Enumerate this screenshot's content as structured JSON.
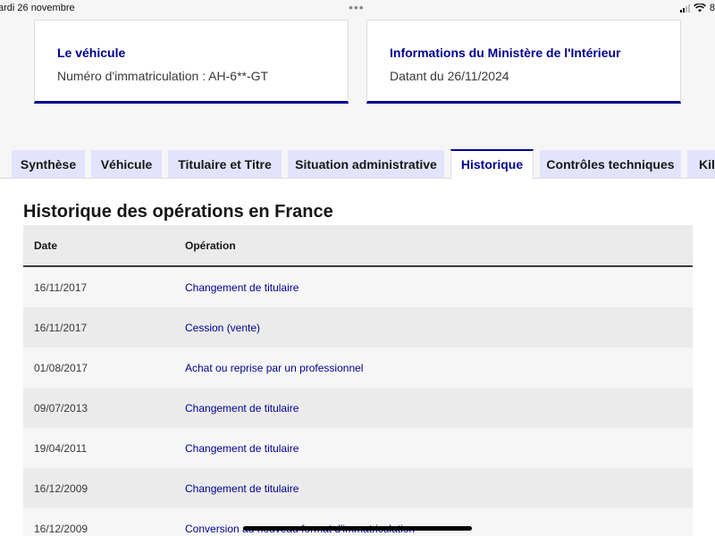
{
  "status_bar": {
    "date": "ardi 26 novembre",
    "battery": "8"
  },
  "cards": [
    {
      "title": "Le véhicule",
      "text": "Numéro d'immatriculation : AH-6**-GT"
    },
    {
      "title": "Informations du Ministère de l'Intérieur",
      "text": "Datant du 26/11/2024"
    }
  ],
  "tabs": [
    {
      "label": "Synthèse",
      "active": false
    },
    {
      "label": "Véhicule",
      "active": false
    },
    {
      "label": "Titulaire et Titre",
      "active": false
    },
    {
      "label": "Situation administrative",
      "active": false
    },
    {
      "label": "Historique",
      "active": true
    },
    {
      "label": "Contrôles techniques",
      "active": false
    },
    {
      "label": "Kilométrage",
      "active": false
    }
  ],
  "history": {
    "title": "Historique des opérations en France",
    "columns": {
      "date": "Date",
      "operation": "Opération"
    },
    "rows": [
      {
        "date": "16/11/2017",
        "operation": "Changement de titulaire"
      },
      {
        "date": "16/11/2017",
        "operation": "Cession (vente)"
      },
      {
        "date": "01/08/2017",
        "operation": "Achat ou reprise par un professionnel"
      },
      {
        "date": "09/07/2013",
        "operation": "Changement de titulaire"
      },
      {
        "date": "19/04/2011",
        "operation": "Changement de titulaire"
      },
      {
        "date": "16/12/2009",
        "operation": "Changement de titulaire"
      },
      {
        "date": "16/12/2009",
        "operation": "Conversion au nouveau format d'immatriculation"
      }
    ]
  },
  "colors": {
    "accent": "#000091",
    "tab_background": "#e3e3fd",
    "row_light": "#f6f6f6",
    "row_dark": "#ebebeb"
  },
  "icons": [
    "more-dots-icon",
    "cellular-signal-icon",
    "wifi-icon"
  ]
}
